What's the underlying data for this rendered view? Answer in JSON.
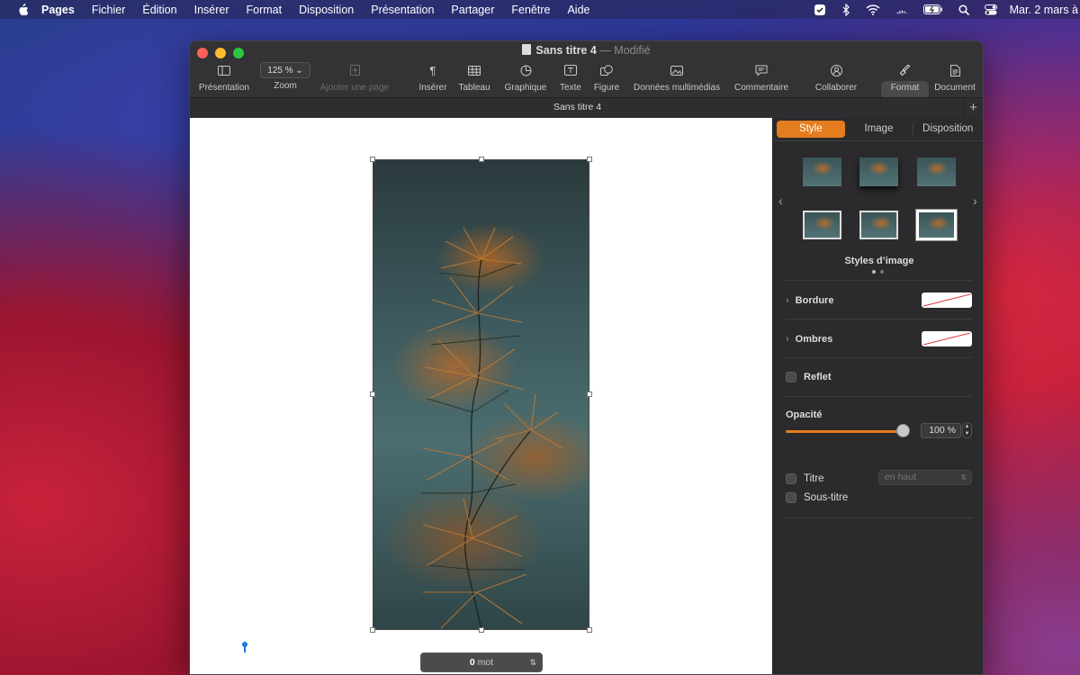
{
  "menubar": {
    "app": "Pages",
    "items": [
      "Fichier",
      "Édition",
      "Insérer",
      "Format",
      "Disposition",
      "Présentation",
      "Partager",
      "Fenêtre",
      "Aide"
    ],
    "clock": "Mar. 2 mars à"
  },
  "window": {
    "title": "Sans titre 4",
    "separator": "—",
    "status": "Modifié",
    "tab_title": "Sans titre 4"
  },
  "toolbar": {
    "presentation": "Présentation",
    "zoom_value": "125 %",
    "zoom": "Zoom",
    "add_page": "Ajouter une page",
    "insert": "Insérer",
    "table": "Tableau",
    "chart": "Graphique",
    "text": "Texte",
    "shape": "Figure",
    "media": "Données multimédias",
    "comment": "Commentaire",
    "collaborate": "Collaborer",
    "format": "Format",
    "document": "Document"
  },
  "canvas": {
    "word_count_value": "0",
    "word_count_unit": "mot"
  },
  "inspector": {
    "tabs": [
      "Style",
      "Image",
      "Disposition"
    ],
    "active_tab": "Style",
    "styles_label": "Styles d’image",
    "border_label": "Bordure",
    "shadows_label": "Ombres",
    "reflection_label": "Reflet",
    "opacity_label": "Opacité",
    "opacity_value": "100 %",
    "opacity_fraction": 1.0,
    "title_label": "Titre",
    "title_position": "en haut",
    "subtitle_label": "Sous-titre"
  },
  "colors": {
    "accent": "#e47d1e",
    "close": "#fe5f57",
    "minimize": "#febc2e",
    "maximize": "#28c840"
  }
}
